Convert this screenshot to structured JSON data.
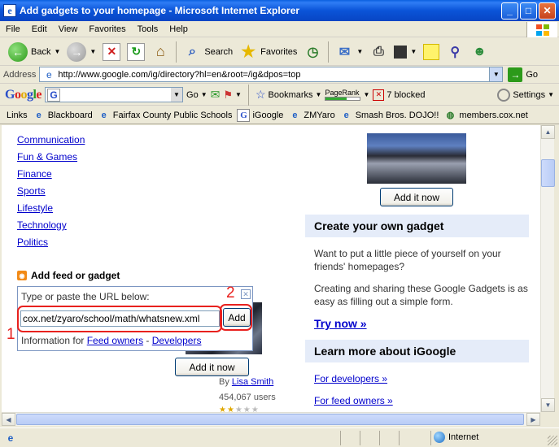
{
  "window": {
    "title": "Add gadgets to your homepage - Microsoft Internet Explorer",
    "minimize": "_",
    "maximize": "□",
    "close": "✕"
  },
  "menu": [
    "File",
    "Edit",
    "View",
    "Favorites",
    "Tools",
    "Help"
  ],
  "toolbar": {
    "back": "Back",
    "search": "Search",
    "favorites": "Favorites"
  },
  "address": {
    "label": "Address",
    "url": "http://www.google.com/ig/directory?hl=en&root=/ig&dpos=top",
    "go": "Go"
  },
  "google_toolbar": {
    "go": "Go",
    "bookmarks": "Bookmarks",
    "pagerank": "PageRank",
    "pagerank_level": 0.6,
    "blocked": "7 blocked",
    "settings": "Settings"
  },
  "links": {
    "label": "Links",
    "items": [
      "Blackboard",
      "Fairfax County Public Schools",
      "iGoogle",
      "ZMYaro",
      "Smash Bros. DOJO!!",
      "members.cox.net"
    ]
  },
  "categories": [
    "Communication",
    "Fun & Games",
    "Finance",
    "Sports",
    "Lifestyle",
    "Technology",
    "Politics"
  ],
  "feed": {
    "title": "Add feed or gadget",
    "popup_label": "Type or paste the URL below:",
    "url_value": "cox.net/zyaro/school/math/whatsnew.xml",
    "add_button": "Add",
    "info_prefix": "Information for ",
    "feed_owners": "Feed owners",
    "dash": " - ",
    "developers": "Developers",
    "annotation_1": "1",
    "annotation_2": "2"
  },
  "gadget_left": {
    "add_now": "Add it now",
    "by": "By ",
    "author": "Lisa Smith",
    "users": "454,067 users",
    "rating": 2
  },
  "gadget_right": {
    "add_now": "Add it now"
  },
  "create": {
    "heading": "Create your own gadget",
    "para1": "Want to put a little piece of yourself on your friends' homepages?",
    "para2": "Creating and sharing these Google Gadgets is as easy as filling out a simple form.",
    "try_now": "Try now »"
  },
  "learn": {
    "heading": "Learn more about iGoogle",
    "developers": "For developers »",
    "feed_owners": "For feed owners »"
  },
  "status": {
    "zone": "Internet"
  }
}
